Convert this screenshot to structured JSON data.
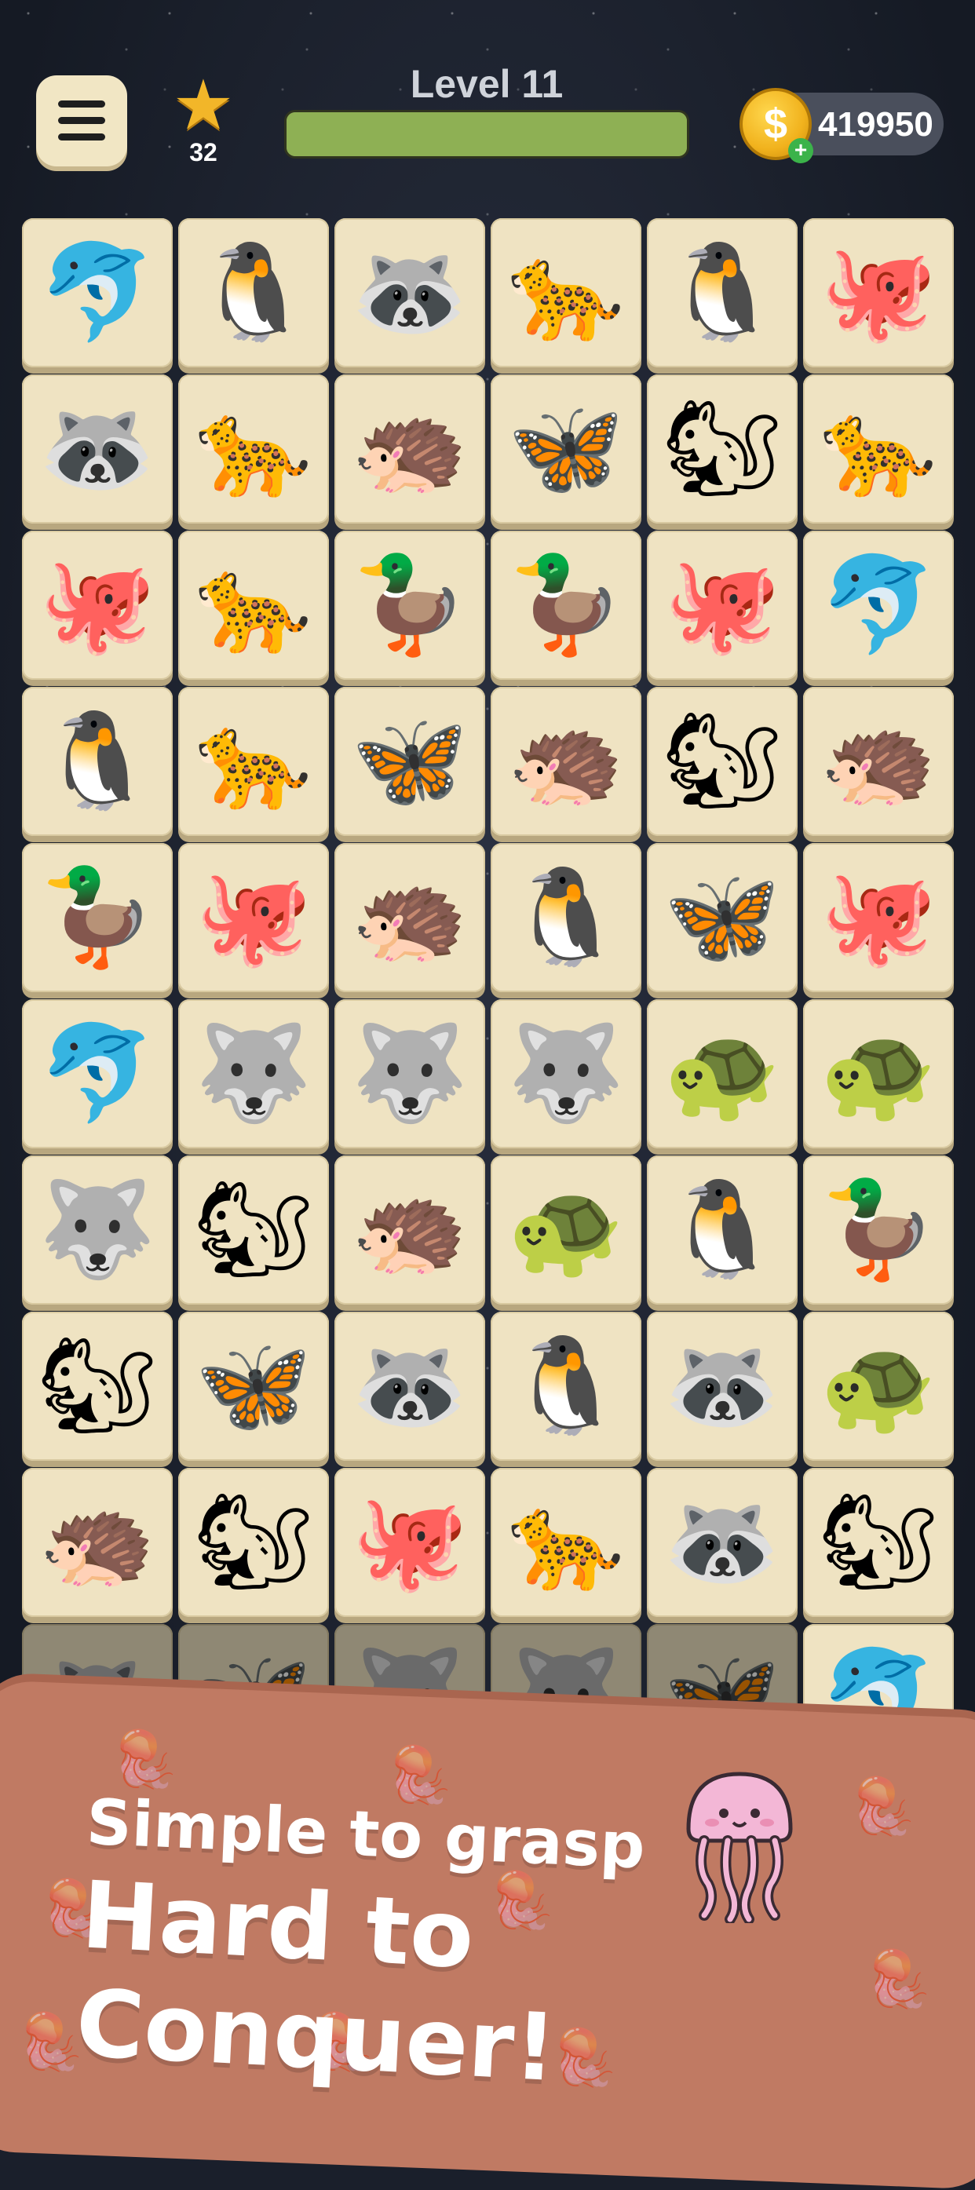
{
  "header": {
    "level_title": "Level 11",
    "stars": "32",
    "coins": "419950",
    "level_progress": 1.0,
    "progress_color": "#8eb054"
  },
  "board": {
    "tiles": [
      [
        "dolphin",
        "penguin",
        "raccoon",
        "leopard",
        "penguin",
        "octopus"
      ],
      [
        "raccoon",
        "leopard",
        "hedgehog",
        "butterfly",
        "squirrel",
        "leopard"
      ],
      [
        "octopus",
        "leopard",
        "duck",
        "duck",
        "octopus",
        "dolphin"
      ],
      [
        "penguin",
        "leopard",
        "butterfly",
        "hedgehog",
        "squirrel",
        "hedgehog"
      ],
      [
        "duck",
        "octopus",
        "hedgehog",
        "penguin",
        "butterfly",
        "octopus"
      ],
      [
        "dolphin",
        "wolf",
        "wolf",
        "wolf",
        "turtle",
        "turtle"
      ],
      [
        "wolf",
        "squirrel",
        "hedgehog",
        "turtle",
        "penguin",
        "duck"
      ],
      [
        "squirrel",
        "butterfly",
        "raccoon",
        "penguin",
        "raccoon",
        "turtle"
      ],
      [
        "hedgehog",
        "squirrel",
        "octopus",
        "leopard",
        "raccoon",
        "squirrel"
      ],
      [
        "raccoon",
        "butterfly",
        "wolf",
        "wolf",
        "butterfly",
        "dolphin"
      ]
    ],
    "icons": {
      "dolphin": "🐬",
      "penguin": "🐧",
      "raccoon": "🦝",
      "leopard": "🐆",
      "octopus": "🐙",
      "hedgehog": "🦔",
      "butterfly": "🦋",
      "squirrel": "🐿",
      "duck": "🦆",
      "wolf": "🐺",
      "turtle": "🐢"
    }
  },
  "banner": {
    "line1": "Simple to grasp",
    "line2": "Hard to Conquer!",
    "color": "#c07a63"
  }
}
